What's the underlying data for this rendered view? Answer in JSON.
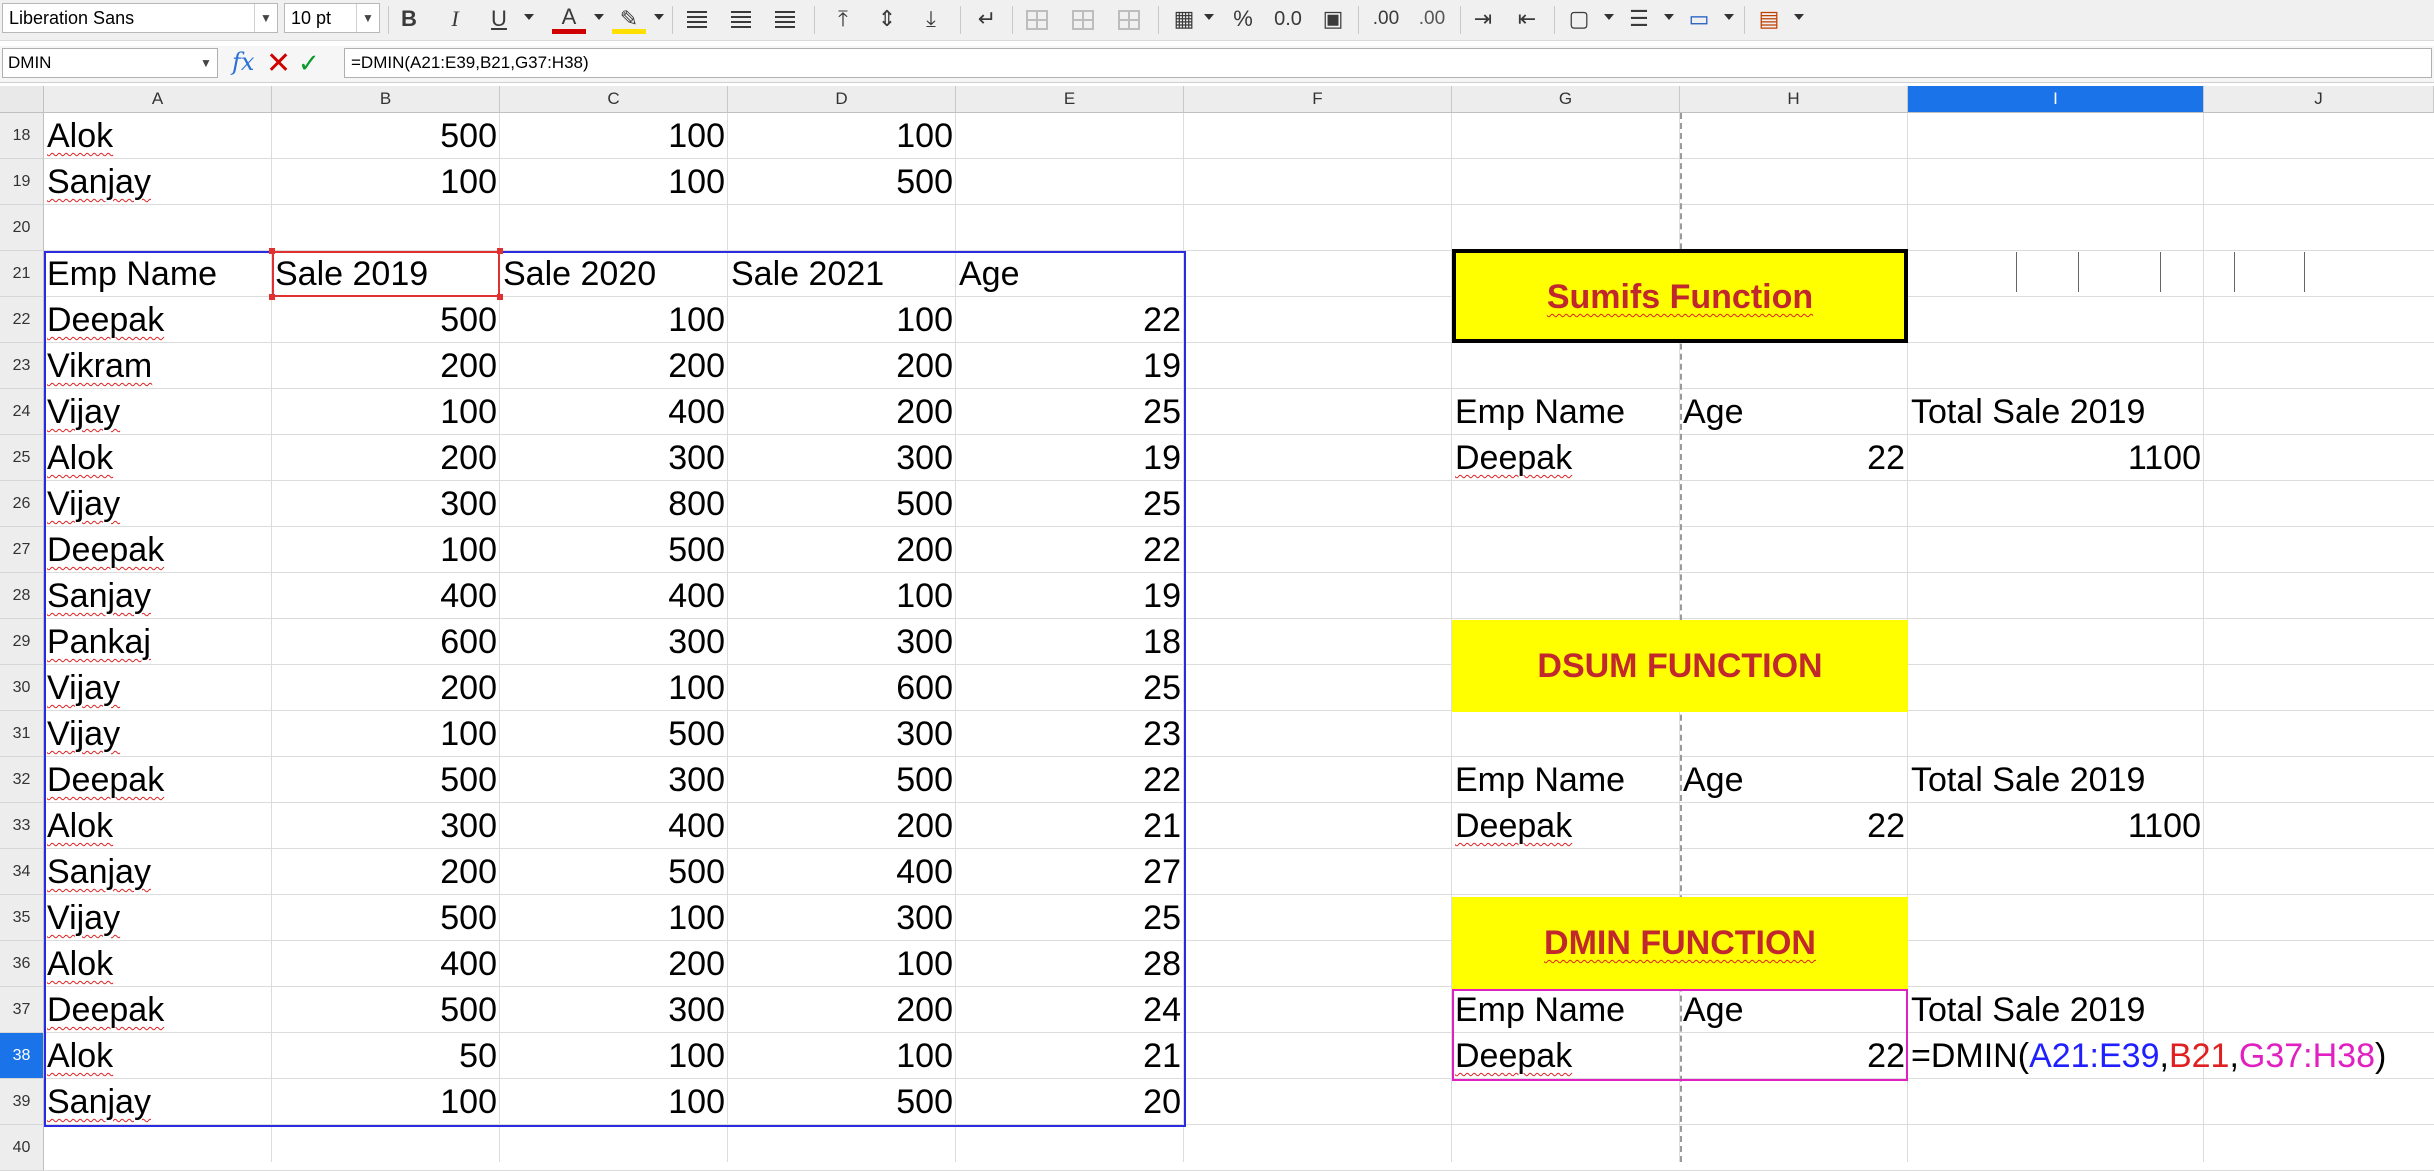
{
  "toolbar": {
    "font_name": "Liberation Sans",
    "font_size": "10 pt",
    "bold": "B",
    "italic": "I",
    "underline": "U",
    "font_color": "A",
    "percent": "%",
    "number_format": "0.0",
    "add_decimal": ".00",
    "remove_decimal": ".00"
  },
  "formula_bar": {
    "name_box": "DMIN",
    "fx": "fx",
    "cancel": "✕",
    "accept": "✓",
    "formula": "=DMIN(A21:E39,B21,G37:H38)"
  },
  "columns": [
    "A",
    "B",
    "C",
    "D",
    "E",
    "F",
    "G",
    "H",
    "I",
    "J"
  ],
  "active_column": "I",
  "rows": [
    "18",
    "19",
    "20",
    "21",
    "22",
    "23",
    "24",
    "25",
    "26",
    "27",
    "28",
    "29",
    "30",
    "31",
    "32",
    "33",
    "34",
    "35",
    "36",
    "37",
    "38",
    "39",
    "40"
  ],
  "active_row": "38",
  "table": {
    "header": [
      "Emp Name",
      "Sale 2019",
      "Sale 2020",
      "Sale 2021",
      "Age"
    ],
    "above": [
      [
        "Alok",
        "500",
        "100",
        "100"
      ],
      [
        "Sanjay",
        "100",
        "100",
        "500"
      ]
    ],
    "rows": [
      [
        "Deepak",
        "500",
        "100",
        "100",
        "22"
      ],
      [
        "Vikram",
        "200",
        "200",
        "200",
        "19"
      ],
      [
        "Vijay",
        "100",
        "400",
        "200",
        "25"
      ],
      [
        "Alok",
        "200",
        "300",
        "300",
        "19"
      ],
      [
        "Vijay",
        "300",
        "800",
        "500",
        "25"
      ],
      [
        "Deepak",
        "100",
        "500",
        "200",
        "22"
      ],
      [
        "Sanjay",
        "400",
        "400",
        "100",
        "19"
      ],
      [
        "Pankaj",
        "600",
        "300",
        "300",
        "18"
      ],
      [
        "Vijay",
        "200",
        "100",
        "600",
        "25"
      ],
      [
        "Vijay",
        "100",
        "500",
        "300",
        "23"
      ],
      [
        "Deepak",
        "500",
        "300",
        "500",
        "22"
      ],
      [
        "Alok",
        "300",
        "400",
        "200",
        "21"
      ],
      [
        "Sanjay",
        "200",
        "500",
        "400",
        "27"
      ],
      [
        "Vijay",
        "500",
        "100",
        "300",
        "25"
      ],
      [
        "Alok",
        "400",
        "200",
        "100",
        "28"
      ],
      [
        "Deepak",
        "500",
        "300",
        "200",
        "24"
      ],
      [
        "Alok",
        "50",
        "100",
        "100",
        "21"
      ],
      [
        "Sanjay",
        "100",
        "100",
        "500",
        "20"
      ]
    ]
  },
  "sections": {
    "sumifs": {
      "title": "Sumifs Function",
      "h1": "Emp Name",
      "h2": "Age",
      "h3": "Total Sale 2019",
      "name": "Deepak",
      "age": "22",
      "total": "1100"
    },
    "dsum": {
      "title": "DSUM FUNCTION",
      "h1": "Emp Name",
      "h2": "Age",
      "h3": "Total Sale 2019",
      "name": "Deepak",
      "age": "22",
      "total": "1100"
    },
    "dmin": {
      "title": "DMIN FUNCTION",
      "h1": "Emp Name",
      "h2": "Age",
      "h3": "Total Sale 2019",
      "name": "Deepak",
      "age": "22",
      "formula_prefix": "=DMIN(",
      "ref1": "A21:E39",
      "comma1": ",",
      "ref2": "B21",
      "comma2": ",",
      "ref3": "G37:H38",
      "formula_suffix": ")"
    }
  },
  "colors": {
    "highlight": "#ffff00",
    "title_text": "#c0282d",
    "ref_blue": "#1f1fff",
    "ref_red": "#e02020",
    "ref_pink": "#e020c0",
    "active_header": "#1a73e8"
  }
}
